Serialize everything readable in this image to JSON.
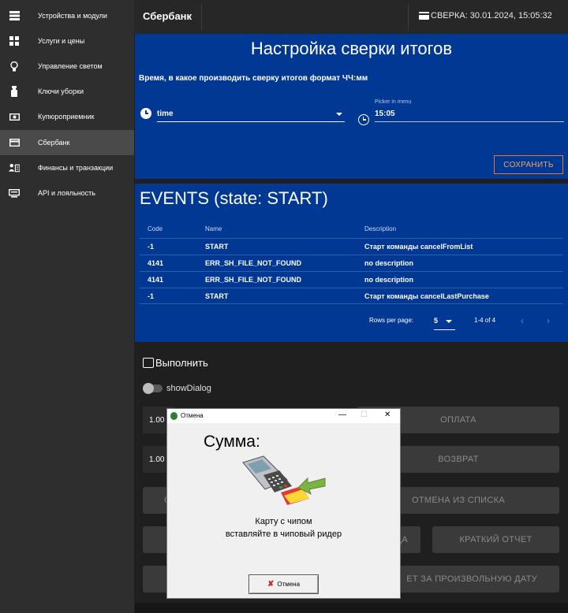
{
  "sidebar": {
    "items": [
      {
        "label": "Устройства и модули",
        "icon": "server-icon"
      },
      {
        "label": "Услуги и цены",
        "icon": "grid-icon"
      },
      {
        "label": "Управление светом",
        "icon": "lightbulb-icon"
      },
      {
        "label": "Ключи уборки",
        "icon": "spray-bottle-icon"
      },
      {
        "label": "Купюроприемник",
        "icon": "banknote-icon"
      },
      {
        "label": "Сбербанк",
        "icon": "credit-card-icon",
        "active": true
      },
      {
        "label": "Финансы и транзакции",
        "icon": "finance-icon"
      },
      {
        "label": "API и лояльность",
        "icon": "monitor-icon"
      }
    ]
  },
  "header": {
    "title": "Сбербанк",
    "reconciliation": "СВЕРКА: 30.01.2024, 15:05:32"
  },
  "settings": {
    "title": "Настройка сверки итогов",
    "subtitle": "Время, в какое производить сверку итогов формат ЧЧ:мм",
    "select_value": "time",
    "picker_label": "Picker in menu",
    "picker_value": "15:05",
    "save_label": "СОХРАНИТЬ"
  },
  "events": {
    "title": "EVENTS (state: START)",
    "columns": [
      "Code",
      "Name",
      "Description"
    ],
    "rows": [
      {
        "code": "-1",
        "name": "START",
        "description": "Старт команды cancelFromList"
      },
      {
        "code": "4141",
        "name": "ERR_SH_FILE_NOT_FOUND",
        "description": "no description"
      },
      {
        "code": "4141",
        "name": "ERR_SH_FILE_NOT_FOUND",
        "description": "no description"
      },
      {
        "code": "-1",
        "name": "START",
        "description": "Старт команды cancelLastPurchase"
      }
    ],
    "rows_per_page_label": "Rows per page:",
    "rows_per_page": "5",
    "range": "1-4 of 4"
  },
  "execute": {
    "title": "Выполнить",
    "toggle_label": "showDialog",
    "amount1": "1.00",
    "amount2": "1.00",
    "buttons": {
      "pay": "ОПЛАТА",
      "refund": "ВОЗВРАТ",
      "cancel_from_list": "ОТМЕНА ИЗ СПИСКА",
      "partial_left": "С",
      "partial_da": "ДА",
      "short_report": "КРАТКИЙ ОТЧЕТ",
      "custom_report": "ЕТ ЗА ПРОИЗВОЛЬНУЮ ДАТУ"
    }
  },
  "dialog": {
    "title": "Отмена",
    "sum_label": "Сумма:",
    "message_line1": "Карту с чипом",
    "message_line2": "вставляйте в чиповый ридер",
    "cancel_label": "Отмена"
  },
  "colors": {
    "panel_blue": "#003893",
    "accent_orange": "#e07a36",
    "sidebar_bg": "#2e2e2e"
  }
}
